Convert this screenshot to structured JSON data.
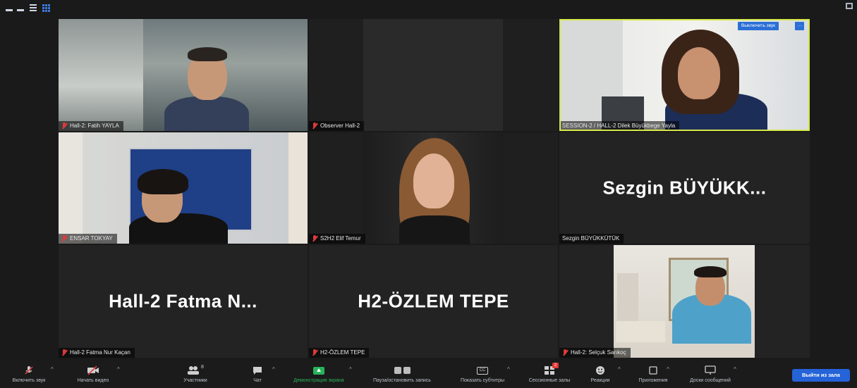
{
  "window": {
    "controls": [
      "minimize-icon",
      "minimize-icon",
      "menu-icon",
      "gallery-grid-icon"
    ],
    "exit_fullscreen_icon": "exit-fullscreen-icon"
  },
  "tiles": [
    {
      "name": "Hall-2: Fatih YAYLA",
      "muted": true
    },
    {
      "name": "Observer Hall-2",
      "muted": true
    },
    {
      "name": "SESSION-2 / HALL-2 Dilek Büyükbege Yayla",
      "muted": false,
      "active_speaker": true,
      "speaker_button": "Выключить звук",
      "more_button": "···"
    },
    {
      "name": "ENSAR TOKYAY",
      "muted": true
    },
    {
      "name": "S2H2 Elif Temur",
      "muted": true
    },
    {
      "name": "Sezgin BÜYÜKKÜTÜK",
      "muted": false,
      "display_text": "Sezgin  BÜYÜKK..."
    },
    {
      "name": "Hall-2 Fatma Nur Kaçan",
      "muted": true,
      "display_text": "Hall-2  Fatma  N..."
    },
    {
      "name": "H2-ÖZLEM TEPE",
      "muted": true,
      "display_text": "H2-ÖZLEM TEPE"
    },
    {
      "name": "Hall-2: Selçuk Sarıkoç",
      "muted": true
    }
  ],
  "toolbar": {
    "mute": "Включить звук",
    "video": "Начать видео",
    "participants": "Участники",
    "participants_count": "8",
    "chat": "Чат",
    "share": "Демонстрация экрана",
    "record": "Пауза/остановить запись",
    "captions": "Показать субтитры",
    "captions_icon_text": "CC",
    "breakout": "Сессионные залы",
    "breakout_badge": "2",
    "reactions": "Реакции",
    "apps": "Приложения",
    "whiteboards": "Доски сообщений",
    "leave": "Выйти из зала"
  },
  "colors": {
    "active_speaker_border": "#d7e84a",
    "share_green": "#27b35a",
    "leave_blue": "#2563d8",
    "muted_red": "#e03a3a"
  }
}
